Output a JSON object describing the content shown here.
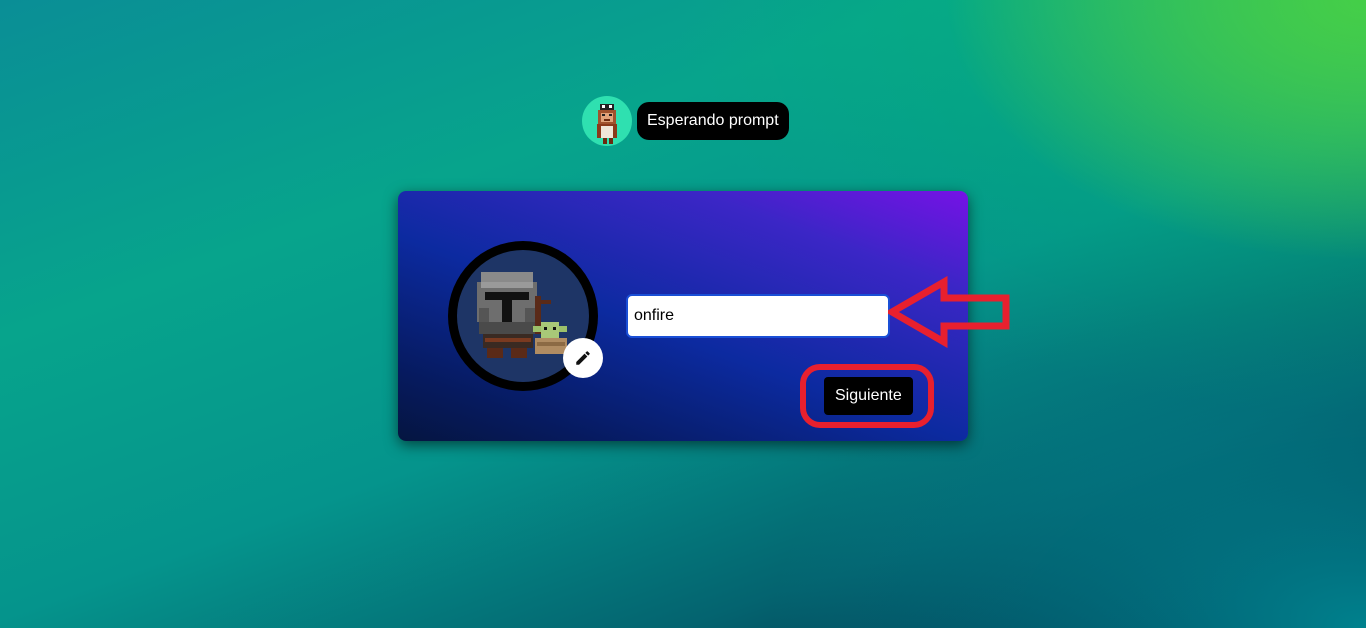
{
  "status": {
    "text": "Esperando prompt",
    "avatar_icon": "pixel-ape-avatar-icon"
  },
  "profile": {
    "avatar_icon": "pixel-mandalorian-avatar-icon",
    "edit_icon": "pencil-icon",
    "username_value": "onfire"
  },
  "actions": {
    "next_label": "Siguiente"
  },
  "annotations": {
    "arrow_icon": "left-arrow-annotation-icon",
    "color": "#e8202e"
  }
}
